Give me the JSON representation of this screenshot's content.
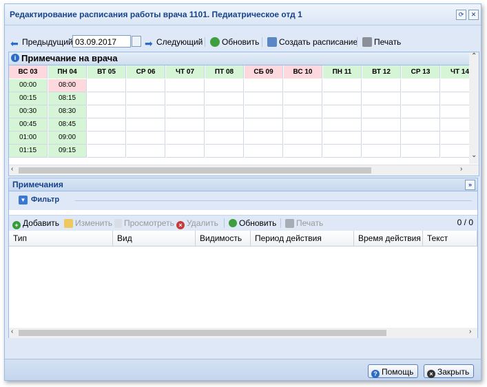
{
  "window": {
    "title": "Редактирование расписания работы врача   1101. Педиатрическое отд 1",
    "refresh_tool": "⟳",
    "close_tool": "✕"
  },
  "toolbar": {
    "prev_label": "Предыдущий",
    "date_value": "03.09.2017",
    "next_label": "Следующий",
    "refresh_label": "Обновить",
    "create_label": "Создать расписание",
    "print_label": "Печать"
  },
  "schedule": {
    "note_header": "Примечание на врача",
    "days": [
      {
        "label": "ВС 03",
        "color": "#fdd8dc"
      },
      {
        "label": "ПН 04",
        "color": "#d6f5d6"
      },
      {
        "label": "ВТ 05",
        "color": "#d6f5d6"
      },
      {
        "label": "СР 06",
        "color": "#d6f5d6"
      },
      {
        "label": "ЧТ 07",
        "color": "#d6f5d6"
      },
      {
        "label": "ПТ 08",
        "color": "#d6f5d6"
      },
      {
        "label": "СБ 09",
        "color": "#fdd8dc"
      },
      {
        "label": "ВС 10",
        "color": "#fdd8dc"
      },
      {
        "label": "ПН 11",
        "color": "#d6f5d6"
      },
      {
        "label": "ВТ 12",
        "color": "#d6f5d6"
      },
      {
        "label": "СР 13",
        "color": "#d6f5d6"
      },
      {
        "label": "ЧТ 14",
        "color": "#d6f5d6"
      }
    ],
    "rows": [
      {
        "time": "00:00",
        "slot": "08:00",
        "slot_color": "#fdd8dc"
      },
      {
        "time": "00:15",
        "slot": "08:15",
        "slot_color": "#d6f5d6"
      },
      {
        "time": "00:30",
        "slot": "08:30",
        "slot_color": "#d6f5d6"
      },
      {
        "time": "00:45",
        "slot": "08:45",
        "slot_color": "#d6f5d6"
      },
      {
        "time": "01:00",
        "slot": "09:00",
        "slot_color": "#d6f5d6"
      },
      {
        "time": "01:15",
        "slot": "09:15",
        "slot_color": "#d6f5d6"
      }
    ],
    "time_color": "#d6f5d6"
  },
  "notes": {
    "header": "Примечания",
    "filter_label": "Фильтр",
    "actions": {
      "add": "Добавить",
      "edit": "Изменить",
      "view": "Просмотреть",
      "delete": "Удалить",
      "refresh": "Обновить",
      "print": "Печать"
    },
    "count": "0 / 0",
    "columns": [
      "Тип",
      "Вид",
      "Видимость",
      "Период действия",
      "Время действия",
      "Текст"
    ]
  },
  "footer": {
    "help_label": "Помощь",
    "close_label": "Закрыть"
  }
}
